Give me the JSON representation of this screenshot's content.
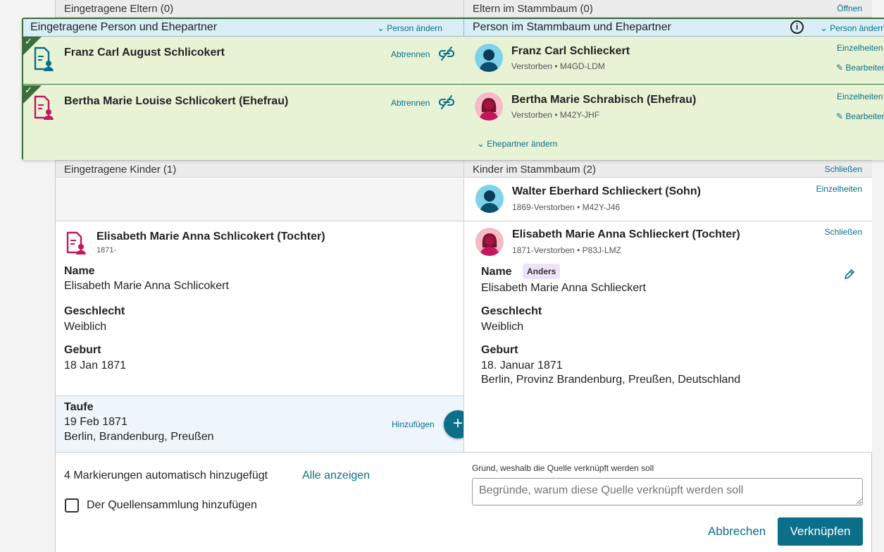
{
  "top_bands": {
    "left_title": "Eingetragene Eltern (0)",
    "right_title": "Eltern im Stammbaum (0)",
    "right_action": "Öffnen"
  },
  "overlay": {
    "left_header": "Eingetragene Person und Ehepartner",
    "left_action": "Person ändern",
    "right_header": "Person im Stammbaum und Ehepartner",
    "right_action": "Person ändern",
    "rows": [
      {
        "record_name": "Franz Carl August Schlicokert",
        "detach_label": "Abtrennen",
        "tree_name": "Franz Carl Schlieckert",
        "tree_meta": "Verstorben • M4GD-LDM",
        "details_label": "Einzelheiten",
        "edit_label": "Bearbeiten"
      },
      {
        "record_name": "Bertha Marie Louise Schlicokert (Ehefrau)",
        "detach_label": "Abtrennen",
        "tree_name": "Bertha Marie Schrabisch (Ehefrau)",
        "tree_meta": "Verstorben • M42Y-JHF",
        "details_label": "Einzelheiten",
        "edit_label": "Bearbeiten"
      }
    ],
    "change_spouse": "Ehepartner ändern"
  },
  "children_bands": {
    "left_title": "Eingetragene Kinder (1)",
    "right_title": "Kinder im Stammbaum (2)",
    "right_action": "Schließen"
  },
  "child_walter": {
    "name": "Walter Eberhard Schlieckert (Sohn)",
    "meta": "1869-Verstorben • M42Y-J46",
    "details_label": "Einzelheiten"
  },
  "child_elisabeth_record": {
    "name": "Elisabeth Marie Anna Schlicokert (Tochter)",
    "meta": "1871-",
    "name_label": "Name",
    "name_value": "Elisabeth Marie Anna Schlicokert",
    "gender_label": "Geschlecht",
    "gender_value": "Weiblich",
    "birth_label": "Geburt",
    "birth_value": "18 Jan 1871",
    "baptism_label": "Taufe",
    "baptism_date": "19 Feb 1871",
    "baptism_place": "Berlin, Brandenburg, Preußen",
    "add_label": "Hinzufügen"
  },
  "child_elisabeth_tree": {
    "name": "Elisabeth Marie Anna Schlieckert (Tochter)",
    "meta": "1871-Verstorben • P83J-LMZ",
    "close_label": "Schließen",
    "name_label": "Name",
    "diff_badge": "Anders",
    "name_value": "Elisabeth Marie Anna Schlieckert",
    "gender_label": "Geschlecht",
    "gender_value": "Weiblich",
    "birth_label": "Geburt",
    "birth_date": "18. Januar 1871",
    "birth_place": "Berlin, Provinz Brandenburg, Preußen, Deutschland"
  },
  "footer": {
    "auto_tags": "4 Markierungen automatisch hinzugefügt",
    "show_all": "Alle anzeigen",
    "add_collection": "Der Quellensammlung hinzufügen",
    "reason_label": "Grund, weshalb die Quelle verknüpft werden soll",
    "reason_placeholder": "Begründe, warum diese Quelle verknüpft werden soll",
    "cancel": "Abbrechen",
    "submit": "Verknüpfen"
  },
  "colors": {
    "accent": "#0b6f8a",
    "match_green": "#3b6e3b",
    "match_bg": "#e8f3d6",
    "female_icon": "#c2185b",
    "male_icon": "#0b6f8a"
  }
}
